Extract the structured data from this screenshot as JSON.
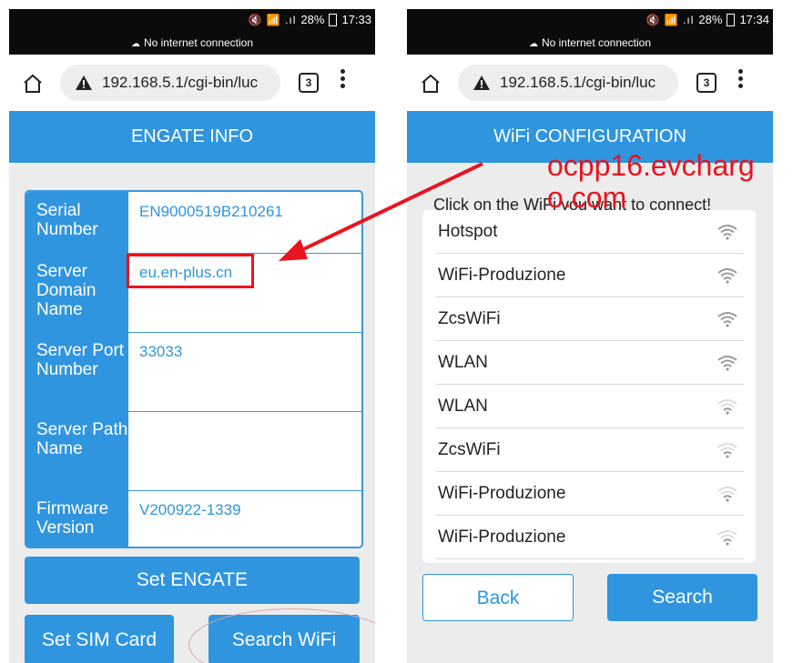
{
  "colors": {
    "primary": "#2f95df",
    "annotation_red": "#e8141e",
    "statusbar": "#0b0b0b"
  },
  "left_phone": {
    "status": {
      "icons": "🔇 📶 .ıl",
      "battery": "28%",
      "time": "17:33",
      "no_internet": "No internet connection"
    },
    "browser": {
      "url": "192.168.5.1/cgi-bin/luc",
      "tab_count": "3"
    },
    "header": "ENGATE INFO",
    "info_rows": [
      {
        "label": "Serial Number",
        "value": "EN9000519B210261"
      },
      {
        "label": "Server Domain Name",
        "value": "eu.en-plus.cn"
      },
      {
        "label": "Server Port Number",
        "value": "33033"
      },
      {
        "label": "Server Path Name",
        "value": ""
      },
      {
        "label": "Firmware Version",
        "value": "V200922-1339"
      }
    ],
    "buttons": {
      "set_engate": "Set ENGATE",
      "set_sim": "Set SIM Card",
      "search_wifi": "Search WiFi"
    }
  },
  "right_phone": {
    "status": {
      "icons": "🔇 📶 .ıl",
      "battery": "28%",
      "time": "17:34",
      "no_internet": "No internet connection"
    },
    "browser": {
      "url": "192.168.5.1/cgi-bin/luc",
      "tab_count": "3"
    },
    "header": "WiFi CONFIGURATION",
    "instruction": "Click on the WiFi you want to connect!",
    "watermark": "ocpp16.evcharg\no.com",
    "wifi_networks": [
      {
        "name": "Hotspot",
        "signal": "full"
      },
      {
        "name": "WiFi-Produzione",
        "signal": "full"
      },
      {
        "name": "ZcsWiFi",
        "signal": "full"
      },
      {
        "name": "WLAN",
        "signal": "full"
      },
      {
        "name": "WLAN",
        "signal": "weak"
      },
      {
        "name": "ZcsWiFi",
        "signal": "weak"
      },
      {
        "name": "WiFi-Produzione",
        "signal": "weak"
      },
      {
        "name": "WiFi-Produzione",
        "signal": "weak"
      }
    ],
    "buttons": {
      "back": "Back",
      "search": "Search"
    }
  }
}
